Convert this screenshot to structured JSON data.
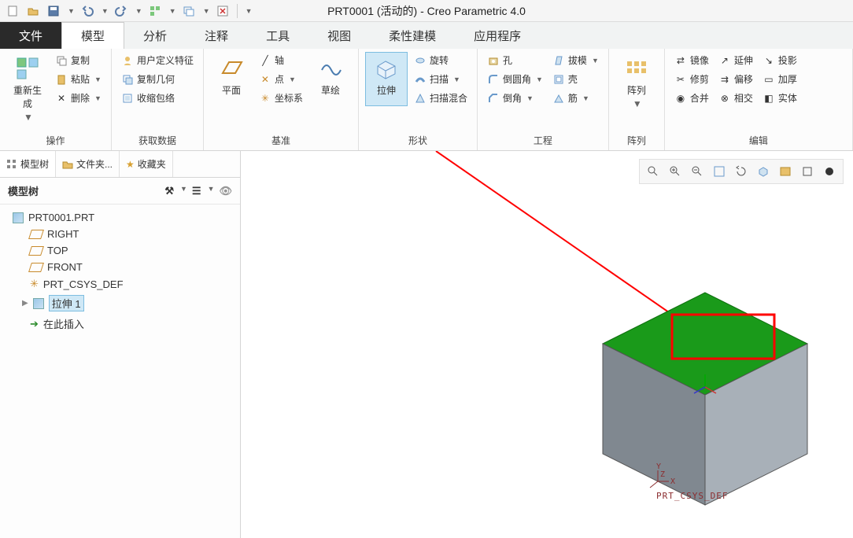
{
  "window_title": "PRT0001 (活动的) - Creo Parametric 4.0",
  "qat_icons": [
    "new-icon",
    "open-icon",
    "save-icon",
    "undo-icon",
    "redo-icon",
    "regen-icon",
    "close-win-icon"
  ],
  "tabs": [
    "文件",
    "模型",
    "分析",
    "注释",
    "工具",
    "视图",
    "柔性建模",
    "应用程序"
  ],
  "ribbon_groups": {
    "operate": {
      "label": "操作",
      "regen": "重新生成",
      "copy": "复制",
      "paste": "粘贴",
      "delete": "删除"
    },
    "getdata": {
      "label": "获取数据",
      "udf": "用户定义特征",
      "copygeom": "复制几何",
      "shrink": "收缩包络"
    },
    "datum": {
      "label": "基准",
      "plane": "平面",
      "axis": "轴",
      "point": "点",
      "csys": "坐标系",
      "sketch": "草绘"
    },
    "shape": {
      "label": "形状",
      "extrude": "拉伸",
      "revolve": "旋转",
      "sweep": "扫描",
      "blend": "扫描混合"
    },
    "eng": {
      "label": "工程",
      "hole": "孔",
      "round": "倒圆角",
      "chamfer": "倒角",
      "draft": "拔模",
      "shell": "壳",
      "rib": "筋"
    },
    "pattern": {
      "label": "阵列",
      "pattern": "阵列"
    },
    "edit": {
      "label": "编辑",
      "mirror": "镜像",
      "trim": "修剪",
      "merge": "合并",
      "extend": "延伸",
      "offset": "偏移",
      "intersect": "相交",
      "project": "投影",
      "thicken": "加厚",
      "solidify": "实体"
    }
  },
  "tree_tabs": {
    "model": "模型树",
    "folder": "文件夹...",
    "fav": "收藏夹"
  },
  "tree_header": "模型树",
  "tree": {
    "root": "PRT0001.PRT",
    "right": "RIGHT",
    "top": "TOP",
    "front": "FRONT",
    "csys": "PRT_CSYS_DEF",
    "extrude": "拉伸 1",
    "insert": "在此插入"
  },
  "csys_label": "PRT_CSYS_DEF"
}
